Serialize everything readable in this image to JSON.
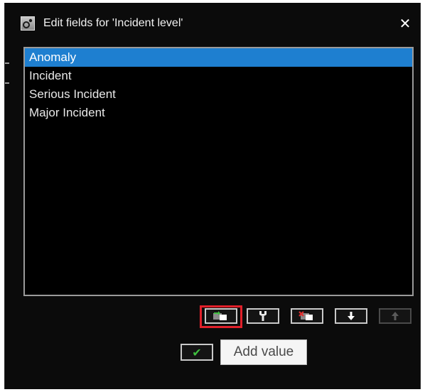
{
  "dialog": {
    "title": "Edit fields for 'Incident level'",
    "title_icon": "settings-window-icon",
    "close_icon": "close-icon",
    "close_glyph": "✕"
  },
  "values_list": {
    "items": [
      {
        "label": "Anomaly",
        "selected": true
      },
      {
        "label": "Incident",
        "selected": false
      },
      {
        "label": "Serious Incident",
        "selected": false
      },
      {
        "label": "Major Incident",
        "selected": false
      }
    ]
  },
  "toolbar": {
    "buttons": [
      {
        "name": "add-value",
        "icon": "add-value-icon",
        "enabled": true,
        "highlighted": true
      },
      {
        "name": "edit-value",
        "icon": "edit-value-icon",
        "enabled": true
      },
      {
        "name": "delete-value",
        "icon": "delete-value-icon",
        "enabled": true
      },
      {
        "name": "move-down",
        "icon": "arrow-down-icon",
        "enabled": true
      },
      {
        "name": "move-up",
        "icon": "arrow-up-icon",
        "enabled": false
      }
    ]
  },
  "ok_button": {
    "icon": "check-icon",
    "glyph": "✔"
  },
  "tooltip": {
    "text": "Add value"
  },
  "colors": {
    "background": "#0b0b0b",
    "selection": "#1e7fd0",
    "highlight_border": "#e0202a",
    "check": "#3fbf3f",
    "delete_accent": "#e03030"
  }
}
